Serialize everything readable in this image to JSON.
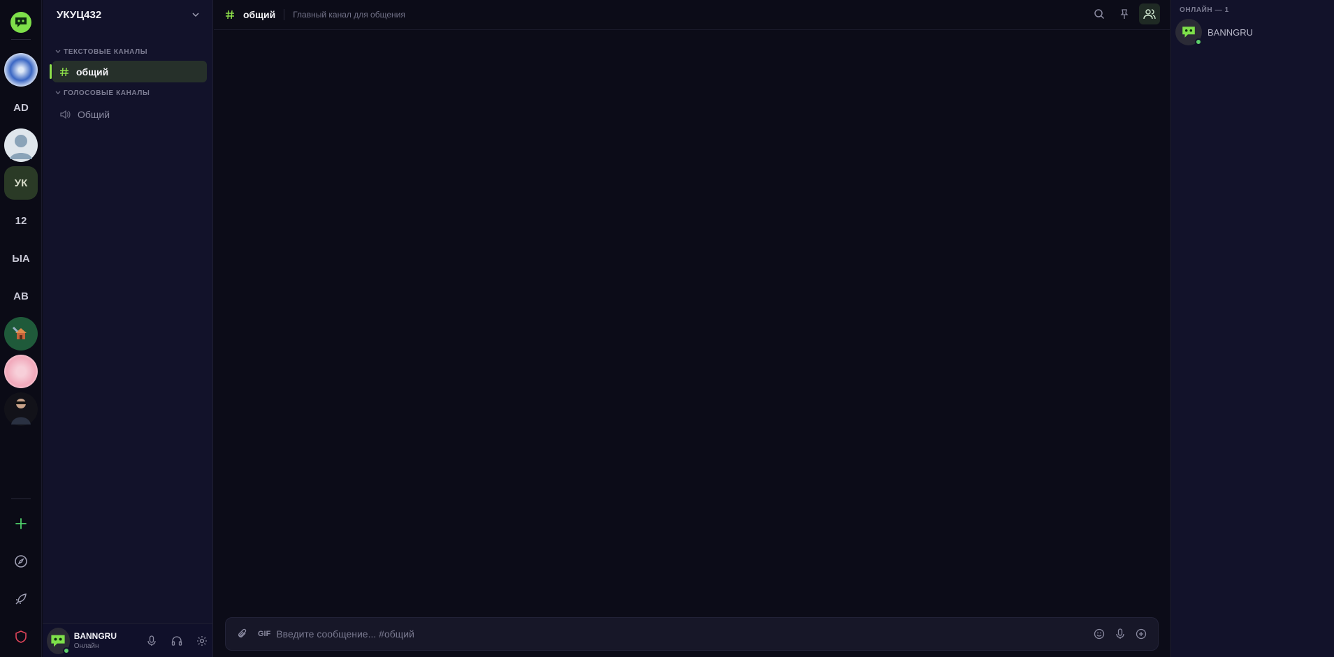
{
  "rail": {
    "servers": [
      {
        "kind": "image",
        "icon": "blue-pattern-server-icon",
        "active": false
      },
      {
        "kind": "text",
        "label": "AD",
        "active": false
      },
      {
        "kind": "image",
        "icon": "default-avatar-server-icon",
        "active": false
      },
      {
        "kind": "text",
        "label": "УК",
        "active": true
      },
      {
        "kind": "text",
        "label": "12",
        "active": false
      },
      {
        "kind": "text",
        "label": "ЫА",
        "active": false
      },
      {
        "kind": "text",
        "label": "АВ",
        "active": false
      },
      {
        "kind": "image",
        "icon": "tools-house-server-icon",
        "active": false
      },
      {
        "kind": "image",
        "icon": "cherry-blossom-server-icon",
        "active": false
      },
      {
        "kind": "image",
        "icon": "person-photo-server-icon",
        "active": false
      }
    ],
    "tools": [
      "add-server-icon",
      "explore-icon",
      "rocket-icon",
      "shield-icon"
    ]
  },
  "server": {
    "name": "УКУЦ432",
    "categories": {
      "text": "ТЕКСТОВЫЕ КАНАЛЫ",
      "voice": "ГОЛОСОВЫЕ КАНАЛЫ"
    },
    "text_channel": "общий",
    "voice_channel": "Общий"
  },
  "user": {
    "name": "BANNGRU",
    "status": "Онлайн"
  },
  "main": {
    "channel_name": "общий",
    "topic": "Главный канал для общения",
    "gif_label": "GIF",
    "placeholder": "Введите сообщение... #общий"
  },
  "members": {
    "header": "ОНЛАЙН — 1",
    "list": [
      {
        "name": "BANNGRU"
      }
    ]
  },
  "colors": {
    "accent": "#8ee04a",
    "online": "#5dd16a",
    "bg_main": "#0c0c18",
    "bg_panel": "#12122a"
  }
}
